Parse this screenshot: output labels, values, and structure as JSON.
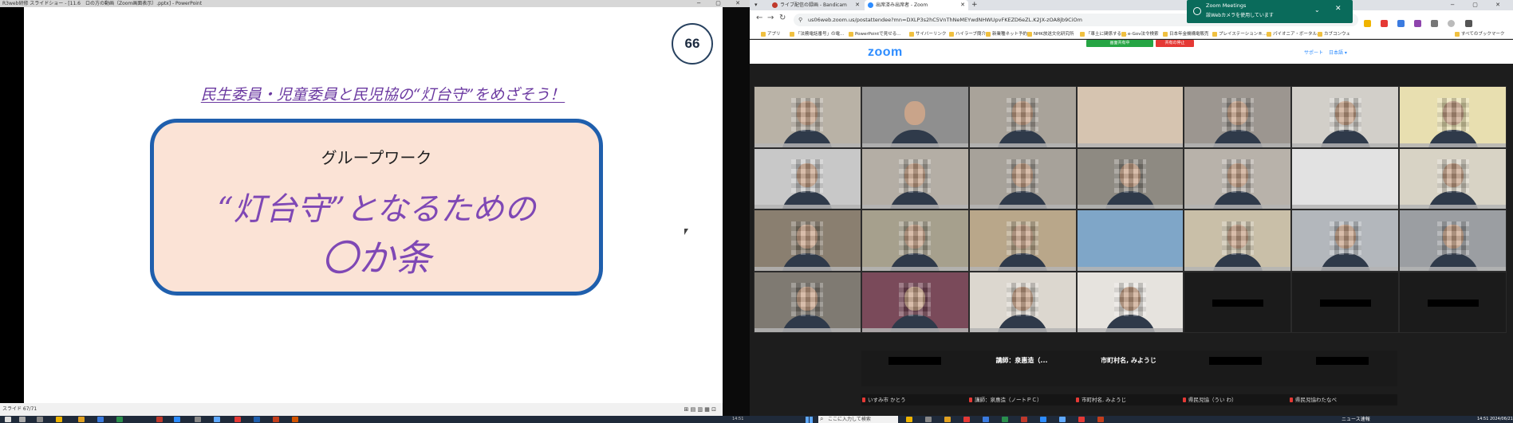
{
  "powerpoint": {
    "title": "R3web研修 スライドショー - [11.6　ロの方の動画（Zoom画面表示）.pptx] - PowerPoint",
    "status_left": "スライド 67/71",
    "status_right": "⊞ ▤ ▥ ▦ ⊡",
    "slide": {
      "number": "66",
      "heading": "民生委員・児童委員と民児協の“灯台守”をめざそう！",
      "box_subtitle": "グループワーク",
      "box_line1": "“灯台守”となるための",
      "box_line2": "〇か条"
    }
  },
  "chrome": {
    "tabs": [
      {
        "label": "ライブ配信の録画 - Bandicam"
      },
      {
        "label": "出席済み出席者 - Zoom"
      }
    ],
    "new_tab": "+",
    "url": "us06web.zoom.us/postattendee?mn=DXLP3s2hC5VnThNeMEYwdNHWUpvFKEZD6eZL.K2JX-zOA8jb9CiOm",
    "bookmarks": [
      "アプリ",
      "「法務電話番号」の電...",
      "PowerPointで見せる...",
      "サイバーリンク",
      "ハイラーブ簡介",
      "新業種ネット予約",
      "NHK放送文化研究所",
      "「車土に関係する ...",
      "e-Gov法令検索",
      "日本年金機構電販売",
      "プレイステーション®...",
      "パイオニア・ボータル...",
      "カブコンウェ",
      "すべてのブックマーク"
    ],
    "notification": {
      "title": "Zoom Meetings",
      "body": "該Webカメラを使用しています"
    }
  },
  "zoom": {
    "logo": "zoom",
    "support": "サポート",
    "language": "日本語 ▾",
    "share_label": "画面共有中",
    "stop_label": "共有の停止",
    "name_slots": [
      {
        "text": ""
      },
      {
        "text": "講師：泉惠造（..."
      },
      {
        "text": "市町村名, みようじ"
      },
      {
        "text": ""
      },
      {
        "text": ""
      }
    ],
    "labels": [
      "いすみ市 かとう",
      "講師：泉惠造（ノートＰＣ）",
      "市町村名, みようじ",
      "県民児協（うい わ）",
      "県民児協わたなべ"
    ]
  },
  "taskbar": {
    "search_placeholder": "ここに入力して検索",
    "news": "ニュース速報",
    "clock": "14:51 2024/06/21",
    "left_clock": "14:51"
  },
  "colors": {
    "slide_purple": "#7f48b5",
    "box_border": "#1f5fad",
    "box_fill": "#fbe3d6",
    "zoom_blue": "#2d8cff",
    "active_speaker": "#23d160"
  }
}
